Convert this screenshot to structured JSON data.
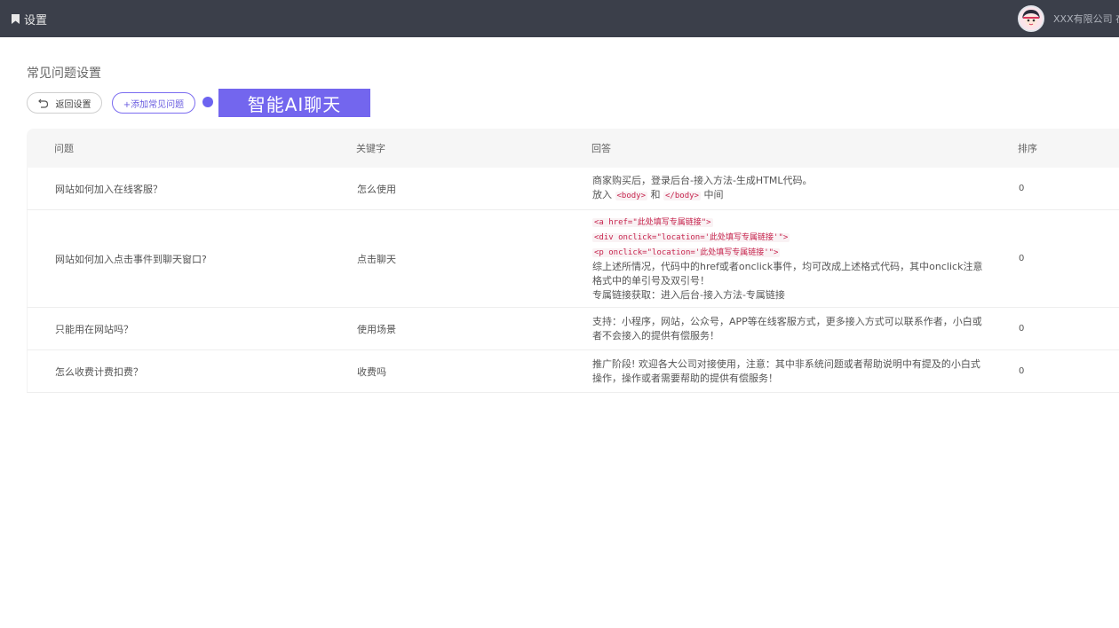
{
  "header": {
    "title": "设置",
    "company": "XXX有限公司 在"
  },
  "page": {
    "title": "常见问题设置",
    "back_label": "返回设置",
    "add_label": "+添加常见问题",
    "ai_banner": "智能AI聊天"
  },
  "table": {
    "columns": [
      "问题",
      "关键字",
      "回答",
      "排序"
    ],
    "rows": [
      {
        "question": "网站如何加入在线客服？",
        "keyword": "怎么使用",
        "answer_line1": "商家购买后，登录后台-接入方法-生成HTML代码。",
        "answer_put": "放入",
        "answer_tag1": "<body>",
        "answer_and": "和",
        "answer_tag2": "</body>",
        "answer_mid": "中间",
        "sort": "0"
      },
      {
        "question": "网站如何加入点击事件到聊天窗口?",
        "keyword": "点击聊天",
        "code1": "<a href=\"此处填写专属链接\">",
        "code2": "<div onclick=\"location='此处填写专属链接'\">",
        "code3": "<p onclick=\"location='此处填写专属链接'\">",
        "answer_text": "综上述所情况，代码中的href或者onclick事件，均可改成上述格式代码，其中onclick注意格式中的单引号及双引号！",
        "answer_tail": "专属链接获取：进入后台-接入方法-专属链接",
        "sort": "0"
      },
      {
        "question": "只能用在网站吗？",
        "keyword": "使用场景",
        "answer": "支持：小程序，网站，公众号，APP等在线客服方式，更多接入方式可以联系作者，小白或者不会接入的提供有偿服务！",
        "sort": "0"
      },
      {
        "question": "怎么收费计费扣费？",
        "keyword": "收费吗",
        "answer": "推广阶段! 欢迎各大公司对接使用，注意：其中非系统问题或者帮助说明中有提及的小白式操作，操作或者需要帮助的提供有偿服务！",
        "sort": "0"
      }
    ]
  },
  "icons": [
    "bookmark-icon",
    "avatar-icon",
    "undo-icon"
  ],
  "colors": {
    "topbar": "#3b3f4a",
    "accent": "#7366ee"
  }
}
